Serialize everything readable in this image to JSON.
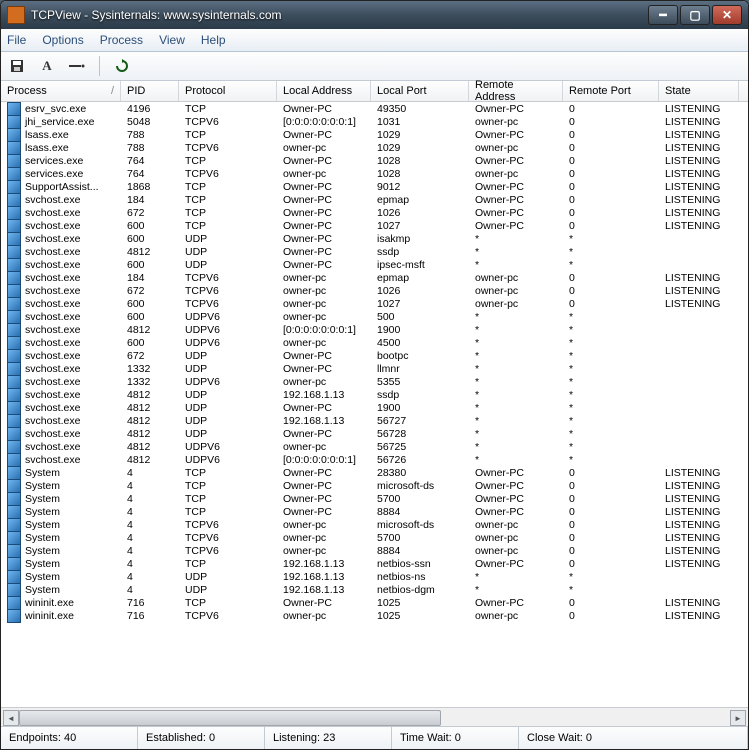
{
  "window": {
    "title": "TCPView - Sysinternals: www.sysinternals.com"
  },
  "menu": {
    "file": "File",
    "options": "Options",
    "process": "Process",
    "view": "View",
    "help": "Help"
  },
  "toolbar_icons": {
    "save": "save-icon",
    "a": "a-icon",
    "rule": "rule-icon",
    "refresh": "refresh-icon"
  },
  "columns": {
    "process": "Process",
    "slash": "/",
    "pid": "PID",
    "protocol": "Protocol",
    "local_address": "Local Address",
    "local_port": "Local Port",
    "remote_address": "Remote Address",
    "remote_port": "Remote Port",
    "state": "State"
  },
  "rows": [
    {
      "process": "esrv_svc.exe",
      "pid": "4196",
      "protocol": "TCP",
      "laddr": "Owner-PC",
      "lport": "49350",
      "raddr": "Owner-PC",
      "rport": "0",
      "state": "LISTENING"
    },
    {
      "process": "jhi_service.exe",
      "pid": "5048",
      "protocol": "TCPV6",
      "laddr": "[0:0:0:0:0:0:0:1]",
      "lport": "1031",
      "raddr": "owner-pc",
      "rport": "0",
      "state": "LISTENING"
    },
    {
      "process": "lsass.exe",
      "pid": "788",
      "protocol": "TCP",
      "laddr": "Owner-PC",
      "lport": "1029",
      "raddr": "Owner-PC",
      "rport": "0",
      "state": "LISTENING"
    },
    {
      "process": "lsass.exe",
      "pid": "788",
      "protocol": "TCPV6",
      "laddr": "owner-pc",
      "lport": "1029",
      "raddr": "owner-pc",
      "rport": "0",
      "state": "LISTENING"
    },
    {
      "process": "services.exe",
      "pid": "764",
      "protocol": "TCP",
      "laddr": "Owner-PC",
      "lport": "1028",
      "raddr": "Owner-PC",
      "rport": "0",
      "state": "LISTENING"
    },
    {
      "process": "services.exe",
      "pid": "764",
      "protocol": "TCPV6",
      "laddr": "owner-pc",
      "lport": "1028",
      "raddr": "owner-pc",
      "rport": "0",
      "state": "LISTENING"
    },
    {
      "process": "SupportAssist...",
      "pid": "1868",
      "protocol": "TCP",
      "laddr": "Owner-PC",
      "lport": "9012",
      "raddr": "Owner-PC",
      "rport": "0",
      "state": "LISTENING"
    },
    {
      "process": "svchost.exe",
      "pid": "184",
      "protocol": "TCP",
      "laddr": "Owner-PC",
      "lport": "epmap",
      "raddr": "Owner-PC",
      "rport": "0",
      "state": "LISTENING"
    },
    {
      "process": "svchost.exe",
      "pid": "672",
      "protocol": "TCP",
      "laddr": "Owner-PC",
      "lport": "1026",
      "raddr": "Owner-PC",
      "rport": "0",
      "state": "LISTENING"
    },
    {
      "process": "svchost.exe",
      "pid": "600",
      "protocol": "TCP",
      "laddr": "Owner-PC",
      "lport": "1027",
      "raddr": "Owner-PC",
      "rport": "0",
      "state": "LISTENING"
    },
    {
      "process": "svchost.exe",
      "pid": "600",
      "protocol": "UDP",
      "laddr": "Owner-PC",
      "lport": "isakmp",
      "raddr": "*",
      "rport": "*",
      "state": ""
    },
    {
      "process": "svchost.exe",
      "pid": "4812",
      "protocol": "UDP",
      "laddr": "Owner-PC",
      "lport": "ssdp",
      "raddr": "*",
      "rport": "*",
      "state": ""
    },
    {
      "process": "svchost.exe",
      "pid": "600",
      "protocol": "UDP",
      "laddr": "Owner-PC",
      "lport": "ipsec-msft",
      "raddr": "*",
      "rport": "*",
      "state": ""
    },
    {
      "process": "svchost.exe",
      "pid": "184",
      "protocol": "TCPV6",
      "laddr": "owner-pc",
      "lport": "epmap",
      "raddr": "owner-pc",
      "rport": "0",
      "state": "LISTENING"
    },
    {
      "process": "svchost.exe",
      "pid": "672",
      "protocol": "TCPV6",
      "laddr": "owner-pc",
      "lport": "1026",
      "raddr": "owner-pc",
      "rport": "0",
      "state": "LISTENING"
    },
    {
      "process": "svchost.exe",
      "pid": "600",
      "protocol": "TCPV6",
      "laddr": "owner-pc",
      "lport": "1027",
      "raddr": "owner-pc",
      "rport": "0",
      "state": "LISTENING"
    },
    {
      "process": "svchost.exe",
      "pid": "600",
      "protocol": "UDPV6",
      "laddr": "owner-pc",
      "lport": "500",
      "raddr": "*",
      "rport": "*",
      "state": ""
    },
    {
      "process": "svchost.exe",
      "pid": "4812",
      "protocol": "UDPV6",
      "laddr": "[0:0:0:0:0:0:0:1]",
      "lport": "1900",
      "raddr": "*",
      "rport": "*",
      "state": ""
    },
    {
      "process": "svchost.exe",
      "pid": "600",
      "protocol": "UDPV6",
      "laddr": "owner-pc",
      "lport": "4500",
      "raddr": "*",
      "rport": "*",
      "state": ""
    },
    {
      "process": "svchost.exe",
      "pid": "672",
      "protocol": "UDP",
      "laddr": "Owner-PC",
      "lport": "bootpc",
      "raddr": "*",
      "rport": "*",
      "state": ""
    },
    {
      "process": "svchost.exe",
      "pid": "1332",
      "protocol": "UDP",
      "laddr": "Owner-PC",
      "lport": "llmnr",
      "raddr": "*",
      "rport": "*",
      "state": ""
    },
    {
      "process": "svchost.exe",
      "pid": "1332",
      "protocol": "UDPV6",
      "laddr": "owner-pc",
      "lport": "5355",
      "raddr": "*",
      "rport": "*",
      "state": ""
    },
    {
      "process": "svchost.exe",
      "pid": "4812",
      "protocol": "UDP",
      "laddr": "192.168.1.13",
      "lport": "ssdp",
      "raddr": "*",
      "rport": "*",
      "state": ""
    },
    {
      "process": "svchost.exe",
      "pid": "4812",
      "protocol": "UDP",
      "laddr": "Owner-PC",
      "lport": "1900",
      "raddr": "*",
      "rport": "*",
      "state": ""
    },
    {
      "process": "svchost.exe",
      "pid": "4812",
      "protocol": "UDP",
      "laddr": "192.168.1.13",
      "lport": "56727",
      "raddr": "*",
      "rport": "*",
      "state": ""
    },
    {
      "process": "svchost.exe",
      "pid": "4812",
      "protocol": "UDP",
      "laddr": "Owner-PC",
      "lport": "56728",
      "raddr": "*",
      "rport": "*",
      "state": ""
    },
    {
      "process": "svchost.exe",
      "pid": "4812",
      "protocol": "UDPV6",
      "laddr": "owner-pc",
      "lport": "56725",
      "raddr": "*",
      "rport": "*",
      "state": ""
    },
    {
      "process": "svchost.exe",
      "pid": "4812",
      "protocol": "UDPV6",
      "laddr": "[0:0:0:0:0:0:0:1]",
      "lport": "56726",
      "raddr": "*",
      "rport": "*",
      "state": ""
    },
    {
      "process": "System",
      "pid": "4",
      "protocol": "TCP",
      "laddr": "Owner-PC",
      "lport": "28380",
      "raddr": "Owner-PC",
      "rport": "0",
      "state": "LISTENING"
    },
    {
      "process": "System",
      "pid": "4",
      "protocol": "TCP",
      "laddr": "Owner-PC",
      "lport": "microsoft-ds",
      "raddr": "Owner-PC",
      "rport": "0",
      "state": "LISTENING"
    },
    {
      "process": "System",
      "pid": "4",
      "protocol": "TCP",
      "laddr": "Owner-PC",
      "lport": "5700",
      "raddr": "Owner-PC",
      "rport": "0",
      "state": "LISTENING"
    },
    {
      "process": "System",
      "pid": "4",
      "protocol": "TCP",
      "laddr": "Owner-PC",
      "lport": "8884",
      "raddr": "Owner-PC",
      "rport": "0",
      "state": "LISTENING"
    },
    {
      "process": "System",
      "pid": "4",
      "protocol": "TCPV6",
      "laddr": "owner-pc",
      "lport": "microsoft-ds",
      "raddr": "owner-pc",
      "rport": "0",
      "state": "LISTENING"
    },
    {
      "process": "System",
      "pid": "4",
      "protocol": "TCPV6",
      "laddr": "owner-pc",
      "lport": "5700",
      "raddr": "owner-pc",
      "rport": "0",
      "state": "LISTENING"
    },
    {
      "process": "System",
      "pid": "4",
      "protocol": "TCPV6",
      "laddr": "owner-pc",
      "lport": "8884",
      "raddr": "owner-pc",
      "rport": "0",
      "state": "LISTENING"
    },
    {
      "process": "System",
      "pid": "4",
      "protocol": "TCP",
      "laddr": "192.168.1.13",
      "lport": "netbios-ssn",
      "raddr": "Owner-PC",
      "rport": "0",
      "state": "LISTENING"
    },
    {
      "process": "System",
      "pid": "4",
      "protocol": "UDP",
      "laddr": "192.168.1.13",
      "lport": "netbios-ns",
      "raddr": "*",
      "rport": "*",
      "state": ""
    },
    {
      "process": "System",
      "pid": "4",
      "protocol": "UDP",
      "laddr": "192.168.1.13",
      "lport": "netbios-dgm",
      "raddr": "*",
      "rport": "*",
      "state": ""
    },
    {
      "process": "wininit.exe",
      "pid": "716",
      "protocol": "TCP",
      "laddr": "Owner-PC",
      "lport": "1025",
      "raddr": "Owner-PC",
      "rport": "0",
      "state": "LISTENING"
    },
    {
      "process": "wininit.exe",
      "pid": "716",
      "protocol": "TCPV6",
      "laddr": "owner-pc",
      "lport": "1025",
      "raddr": "owner-pc",
      "rport": "0",
      "state": "LISTENING"
    }
  ],
  "status": {
    "endpoints": "Endpoints: 40",
    "established": "Established: 0",
    "listening": "Listening: 23",
    "time_wait": "Time Wait: 0",
    "close_wait": "Close Wait: 0"
  }
}
